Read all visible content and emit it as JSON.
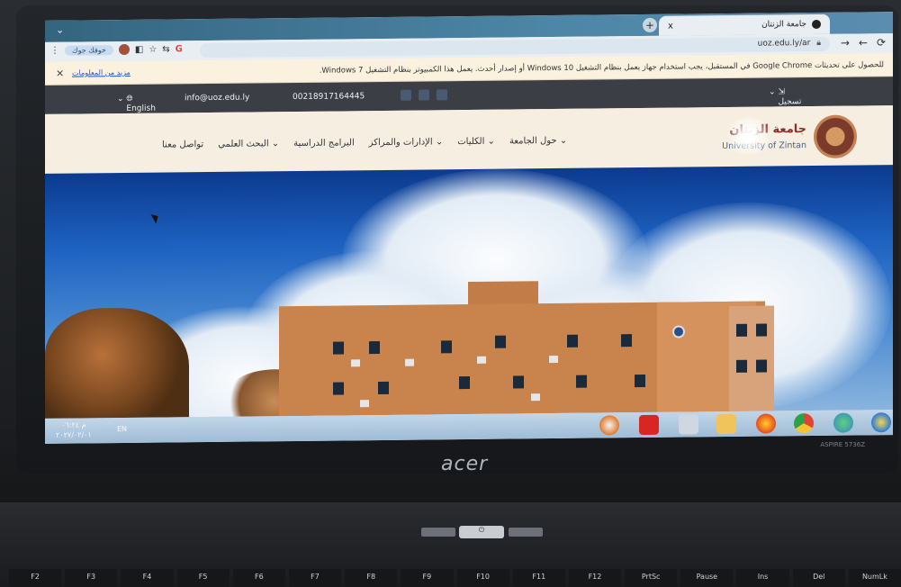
{
  "browser": {
    "tab_title": "جامعة الزنتان",
    "tab_close": "x",
    "new_tab": "+",
    "url": "uoz.edu.ly/ar",
    "profile_label": "خوفك جوك",
    "nav_icons": [
      "→",
      "←",
      "⟳"
    ]
  },
  "infobar": {
    "message": "للحصول على تحديثات Google Chrome في المستقبل، يجب استخدام جهاز يعمل بنظام التشغيل Windows 10 أو إصدار أحدث. يعمل هذا الكمبيوتر بنظام التشغيل Windows 7.",
    "link": "مزيد من المعلومات",
    "close": "×"
  },
  "site": {
    "topbar": {
      "language": "English",
      "email": "info@uoz.edu.ly",
      "phone": "00218917164445",
      "login": "تسجيل الدخول"
    },
    "logo": {
      "name_ar": "جامعة الزنتان",
      "name_en": "University of Zintan"
    },
    "menu": [
      "حول الجامعة",
      "الكليات",
      "الإدارات والمراكز",
      "البرامج الدراسية",
      "البحث العلمي",
      "تواصل معنا"
    ]
  },
  "taskbar": {
    "time": "م ٠٦:٢٤",
    "date": "٢٠٢٧/٠٢/٠١",
    "lang": "EN"
  },
  "laptop": {
    "brand": "acer",
    "model": "ASPIRE 5736Z",
    "power_label": "⏻",
    "fkeys": [
      "F2",
      "F3",
      "F4",
      "F5",
      "F6",
      "F7",
      "F8",
      "F9",
      "F10",
      "F11",
      "F12",
      "PrtSc",
      "Pause",
      "Ins",
      "Del",
      "NumLk"
    ]
  },
  "colors": {
    "site_topbar": "#3b3f45",
    "logo_red": "#8d2c2c",
    "sky": "#1d61c0",
    "building": "#c9844e"
  }
}
